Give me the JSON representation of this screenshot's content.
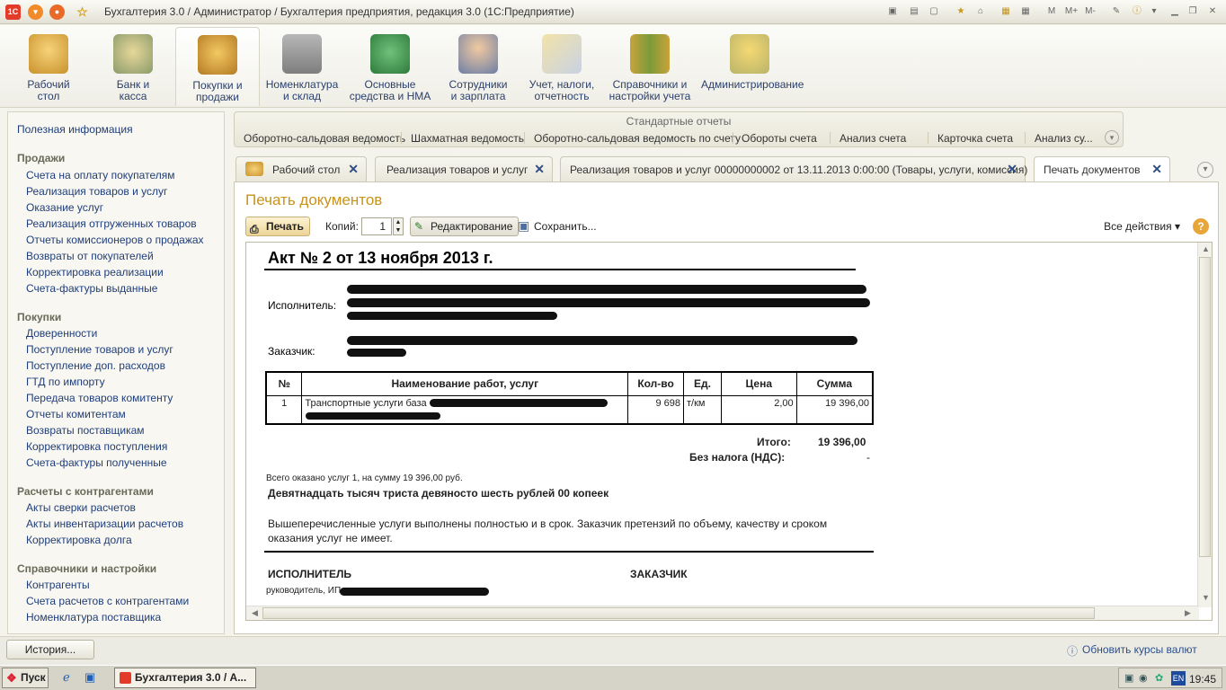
{
  "window": {
    "title": "Бухгалтерия 3.0 / Администратор / Бухгалтерия предприятия, редакция 3.0  (1С:Предприятие)",
    "app_icon": "1c-logo-icon",
    "window_controls": [
      "М",
      "М+",
      "М-"
    ]
  },
  "sections": [
    {
      "line1": "Рабочий",
      "line2": "стол",
      "icon": "desk-icon"
    },
    {
      "line1": "Банк и",
      "line2": "касса",
      "icon": "money-icon"
    },
    {
      "line1": "Покупки и",
      "line2": "продажи",
      "icon": "truck-icon"
    },
    {
      "line1": "Номенклатура",
      "line2": "и склад",
      "icon": "warehouse-icon"
    },
    {
      "line1": "Основные",
      "line2": "средства и НМА",
      "icon": "equipment-icon"
    },
    {
      "line1": "Сотрудники",
      "line2": "и зарплата",
      "icon": "employee-icon"
    },
    {
      "line1": "Учет, налоги,",
      "line2": "отчетность",
      "icon": "report-icon"
    },
    {
      "line1": "Справочники и",
      "line2": "настройки учета",
      "icon": "binders-icon"
    },
    {
      "line1": "Администрирование",
      "line2": "",
      "icon": "admin-icon"
    }
  ],
  "left_panel": {
    "top_link": "Полезная информация",
    "groups": [
      {
        "title": "Продажи",
        "items": [
          "Счета на оплату покупателям",
          "Реализация товаров и услуг",
          "Оказание услуг",
          "Реализация отгруженных товаров",
          "Отчеты комиссионеров о продажах",
          "Возвраты от покупателей",
          "Корректировка реализации",
          "Счета-фактуры выданные"
        ]
      },
      {
        "title": "Покупки",
        "items": [
          "Доверенности",
          "Поступление товаров и услуг",
          "Поступление доп. расходов",
          "ГТД по импорту",
          "Передача товаров комитенту",
          "Отчеты комитентам",
          "Возвраты поставщикам",
          "Корректировка поступления",
          "Счета-фактуры полученные"
        ]
      },
      {
        "title": "Расчеты с контрагентами",
        "items": [
          "Акты сверки расчетов",
          "Акты инвентаризации расчетов",
          "Корректировка долга"
        ]
      },
      {
        "title": "Справочники и настройки",
        "items": [
          "Контрагенты",
          "Счета расчетов с контрагентами",
          "Номенклатура поставщика"
        ]
      }
    ]
  },
  "std_reports": {
    "title": "Стандартные отчеты",
    "items": [
      "Оборотно-сальдовая ведомость",
      "Шахматная ведомость",
      "Оборотно-сальдовая ведомость по счету",
      "Обороты счета",
      "Анализ счета",
      "Карточка счета",
      "Анализ су..."
    ]
  },
  "tabs": [
    {
      "label": "Рабочий стол",
      "active": false
    },
    {
      "label": "Реализация товаров и услуг",
      "active": false
    },
    {
      "label": "Реализация товаров и услуг 00000000002 от 13.11.2013 0:00:00 (Товары, услуги, комиссия)",
      "active": false
    },
    {
      "label": "Печать документов",
      "active": true
    }
  ],
  "print_form": {
    "title": "Печать документов",
    "print_btn": "Печать",
    "copies_label": "Копий:",
    "copies_value": "1",
    "edit_btn": "Редактирование",
    "save_btn": "Сохранить...",
    "all_actions": "Все действия",
    "help": "?"
  },
  "act": {
    "title": "Акт № 2 от 13 ноября 2013 г.",
    "executor_label": "Исполнитель:",
    "customer_label": "Заказчик:",
    "headers": [
      "№",
      "Наименование работ, услуг",
      "Кол-во",
      "Ед.",
      "Цена",
      "Сумма"
    ],
    "rows": [
      {
        "n": "1",
        "name": "Транспортные услуги база",
        "qty": "9 698",
        "unit": "т/км",
        "price": "2,00",
        "sum": "19 396,00"
      }
    ],
    "total_label": "Итого:",
    "total_value": "19 396,00",
    "vat_label": "Без налога (НДС):",
    "vat_value": "-",
    "summary": "Всего оказано услуг 1, на сумму 19 396,00 руб.",
    "words": "Девятнадцать тысяч триста девяносто шесть рублей 00 копеек",
    "note": "Вышеперечисленные услуги выполнены полностью и в срок. Заказчик претензий по объему, качеству и сроком оказания услуг не имеет.",
    "executor_sign": "ИСПОЛНИТЕЛЬ",
    "customer_sign": "ЗАКАЗЧИК",
    "head_label": "руководитель, ИП"
  },
  "status": {
    "history_btn": "История...",
    "rates_link": "Обновить курсы валют"
  },
  "taskbar": {
    "start": "Пуск",
    "task": "Бухгалтерия 3.0 / А...",
    "lang": "EN",
    "clock": "19:45"
  }
}
